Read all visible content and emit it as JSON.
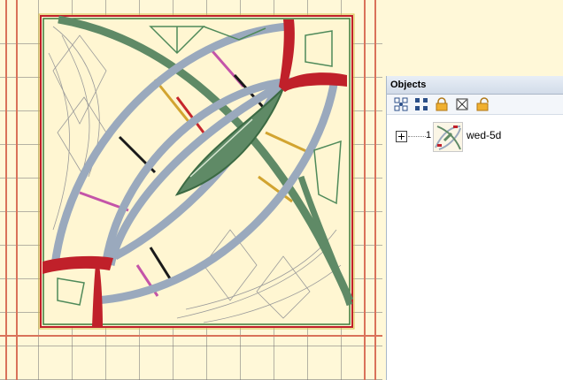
{
  "panel": {
    "title": "Objects",
    "toolbar": [
      {
        "name": "group-objects-icon"
      },
      {
        "name": "ungroup-objects-icon"
      },
      {
        "name": "lock-icon"
      },
      {
        "name": "lock-all-icon"
      },
      {
        "name": "unlock-icon"
      }
    ],
    "tree": {
      "items": [
        {
          "index": "1",
          "label": "wed-5d",
          "expanded": false
        }
      ]
    }
  },
  "colors": {
    "canvas_background": "#fff8d8",
    "grid_line": "#8c8c8c",
    "hoop_border": "#d9725a",
    "frame_red": "#c0202a",
    "frame_green": "#3b7a3b",
    "arc_blue": "#9aa9bd",
    "leaf_green": "#5f8a66",
    "corner_red": "#c0202a"
  }
}
